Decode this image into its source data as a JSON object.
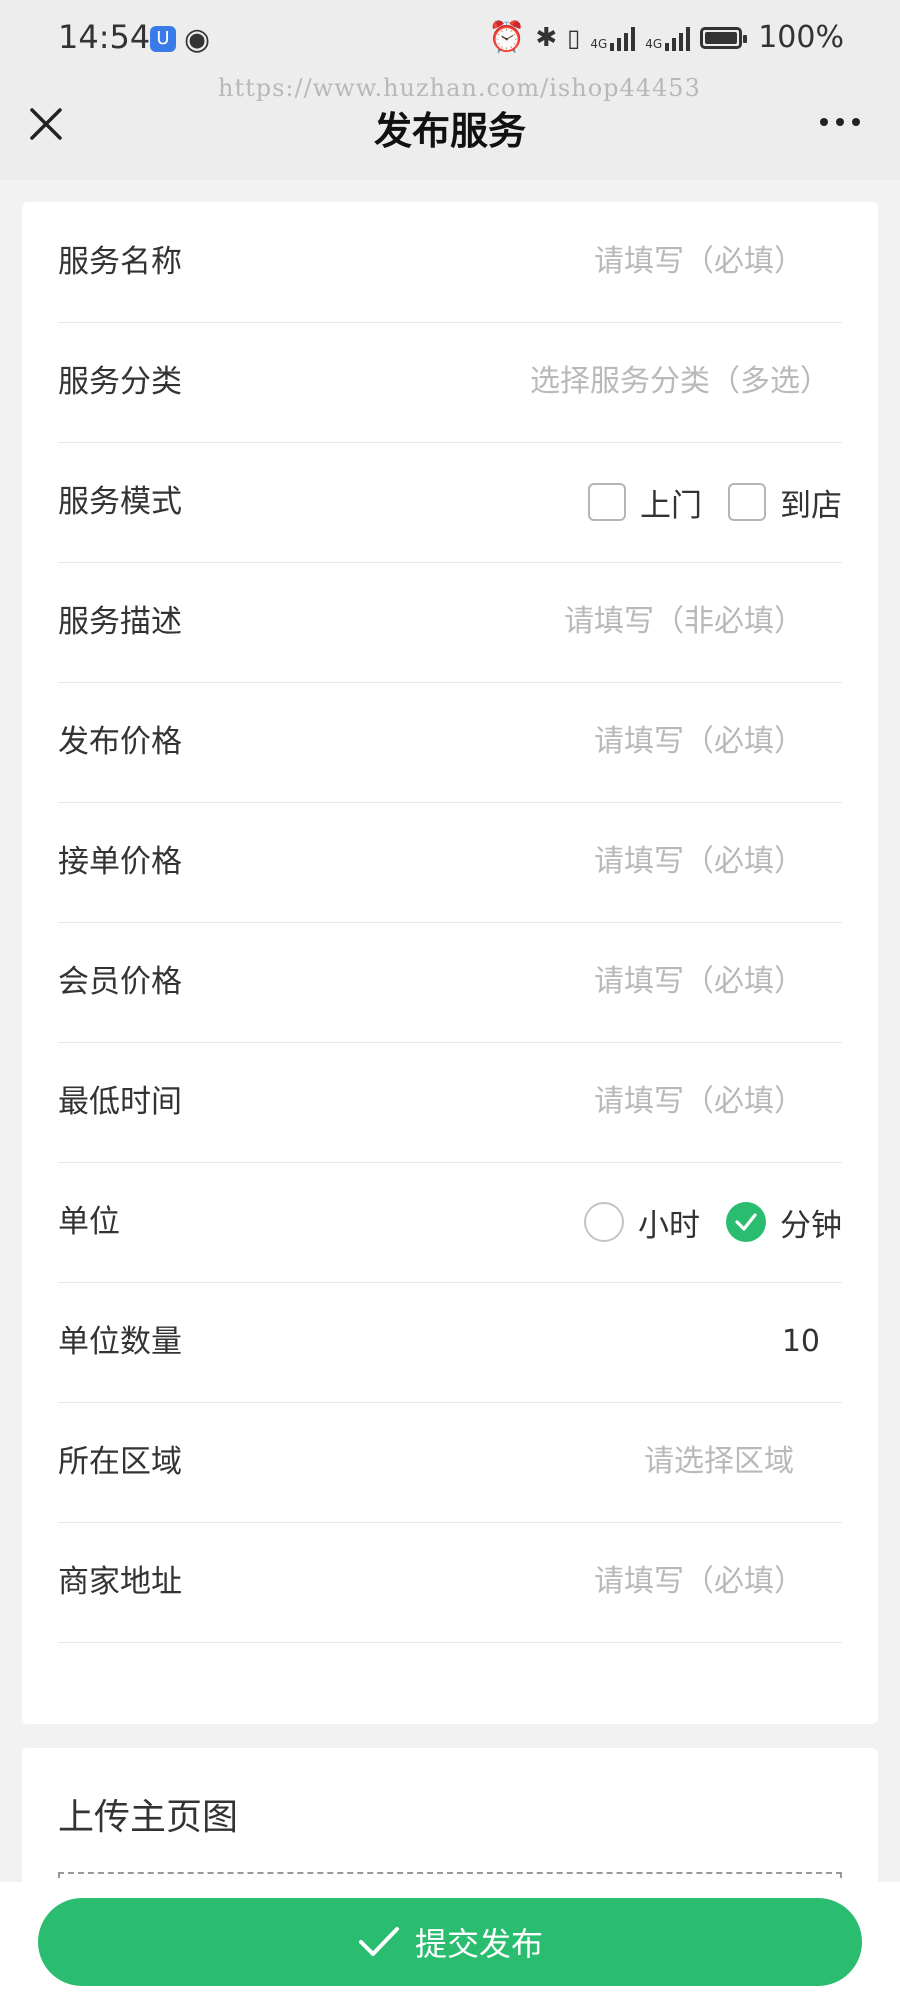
{
  "status_bar": {
    "time": "14:54",
    "battery": "100%",
    "network": [
      "4G",
      "4G"
    ]
  },
  "nav": {
    "title": "发布服务",
    "watermark": "https://www.huzhan.com/ishop44453"
  },
  "form": {
    "rows": [
      {
        "label": "服务名称",
        "placeholder": "请填写（必填）"
      },
      {
        "label": "服务分类",
        "placeholder": "选择服务分类（多选）"
      },
      {
        "label": "服务模式",
        "options": [
          {
            "label": "上门",
            "checked": false
          },
          {
            "label": "到店",
            "checked": false
          }
        ]
      },
      {
        "label": "服务描述",
        "placeholder": "请填写（非必填）"
      },
      {
        "label": "发布价格",
        "placeholder": "请填写（必填）"
      },
      {
        "label": "接单价格",
        "placeholder": "请填写（必填）"
      },
      {
        "label": "会员价格",
        "placeholder": "请填写（必填）"
      },
      {
        "label": "最低时间",
        "placeholder": "请填写（必填）"
      },
      {
        "label": "单位",
        "options": [
          {
            "label": "小时",
            "selected": false
          },
          {
            "label": "分钟",
            "selected": true
          }
        ]
      },
      {
        "label": "单位数量",
        "value": "10"
      },
      {
        "label": "所在区域",
        "placeholder": "请选择区域"
      },
      {
        "label": "商家地址",
        "placeholder": "请填写（必填）"
      }
    ]
  },
  "upload": {
    "title": "上传主页图"
  },
  "submit": {
    "label": "提交发布"
  },
  "colors": {
    "accent": "#2bbd6f",
    "placeholder": "#b9b9b9",
    "text": "#333333"
  }
}
